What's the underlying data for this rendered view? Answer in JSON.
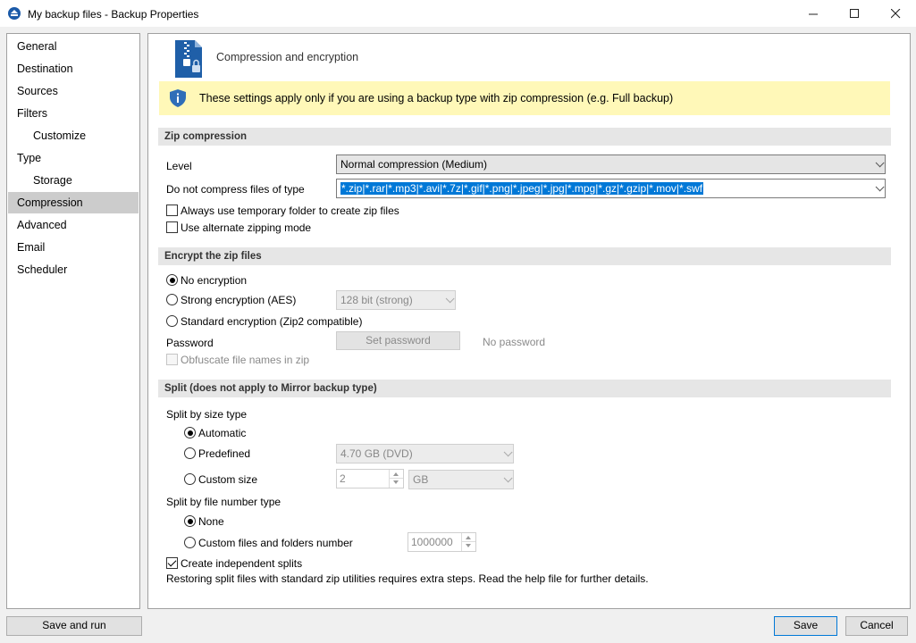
{
  "window": {
    "title": "My backup files - Backup Properties"
  },
  "nav": {
    "items": [
      {
        "label": "General"
      },
      {
        "label": "Destination"
      },
      {
        "label": "Sources"
      },
      {
        "label": "Filters"
      },
      {
        "label": "Customize"
      },
      {
        "label": "Type"
      },
      {
        "label": "Storage"
      },
      {
        "label": "Compression"
      },
      {
        "label": "Advanced"
      },
      {
        "label": "Email"
      },
      {
        "label": "Scheduler"
      }
    ],
    "selected": "Compression"
  },
  "header": {
    "title": "Compression and encryption"
  },
  "info": {
    "text": "These settings apply only if you are using a backup type with zip compression (e.g. Full backup)"
  },
  "zip": {
    "section": "Zip compression",
    "level_label": "Level",
    "level_value": "Normal compression (Medium)",
    "nocompress_label": "Do not compress files of type",
    "nocompress_value": "*.zip|*.rar|*.mp3|*.avi|*.7z|*.gif|*.png|*.jpeg|*.jpg|*.mpg|*.gz|*.gzip|*.mov|*.swf",
    "temp_folder_label": "Always use temporary folder to create zip files",
    "alt_mode_label": "Use alternate zipping mode"
  },
  "encrypt": {
    "section": "Encrypt the zip files",
    "none_label": "No encryption",
    "aes_label": "Strong encryption (AES)",
    "aes_strength": "128 bit (strong)",
    "zip2_label": "Standard encryption (Zip2 compatible)",
    "password_label": "Password",
    "set_password": "Set password",
    "no_password": "No password",
    "obfuscate_label": "Obfuscate file names in zip"
  },
  "split": {
    "section": "Split (does not apply to Mirror backup type)",
    "size_type_label": "Split by size type",
    "automatic": "Automatic",
    "predefined": "Predefined",
    "predefined_value": "4.70 GB (DVD)",
    "custom_size": "Custom size",
    "custom_size_value": "2",
    "custom_unit": "GB",
    "file_number_label": "Split by file number type",
    "none": "None",
    "custom_files": "Custom files and folders number",
    "custom_files_value": "1000000",
    "independent_label": "Create independent splits",
    "note": "Restoring split files with standard zip utilities requires extra steps. Read the help file for further details."
  },
  "footer": {
    "save_and_run": "Save and run",
    "save": "Save",
    "cancel": "Cancel"
  }
}
